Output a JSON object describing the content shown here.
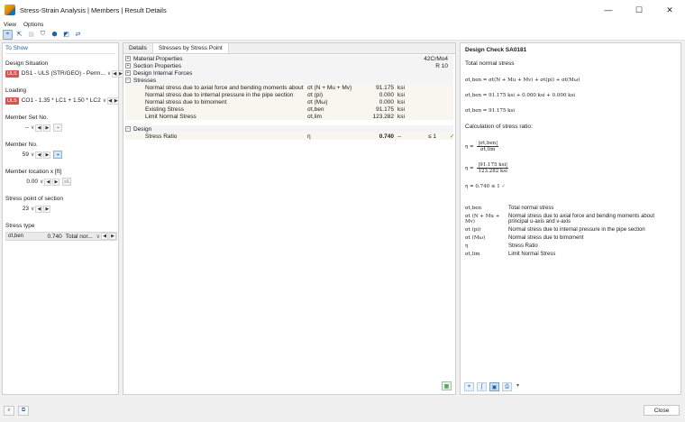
{
  "window": {
    "title": "Stress-Strain Analysis | Members | Result Details",
    "minimize": "—",
    "maximize": "☐",
    "close": "✕"
  },
  "menu": [
    "View",
    "Options"
  ],
  "left": {
    "header": "To Show",
    "design_situation": {
      "label": "Design Situation",
      "badge": "ULS",
      "value": "DS1 - ULS (STR/GEO) - Perm..."
    },
    "loading": {
      "label": "Loading",
      "badge": "ULS",
      "value": "CO1 - 1.35 * LC1 + 1.50 * LC2"
    },
    "member_set": {
      "label": "Member Set No.",
      "value": "--"
    },
    "member": {
      "label": "Member No.",
      "value": "59"
    },
    "location": {
      "label": "Member location x [ft]",
      "value": "0.00"
    },
    "stress_point": {
      "label": "Stress point of section",
      "value": "23"
    },
    "stress_type": {
      "label": "Stress type",
      "symbol": "σt,ben",
      "value": "0.740",
      "desc": "Total nor..."
    }
  },
  "center": {
    "tabs": [
      "Details",
      "Stresses by Stress Point"
    ],
    "sections": {
      "material": {
        "label": "Material Properties",
        "right": "42CrMo4"
      },
      "section": {
        "label": "Section Properties",
        "right": "R 10"
      },
      "internal_forces": {
        "label": "Design Internal Forces"
      },
      "stresses": {
        "label": "Stresses"
      },
      "design": {
        "label": "Design"
      }
    },
    "stress_rows": [
      {
        "label": "Normal stress due to axial force and bending moments about prin...",
        "sym": "σt (N + Mu + Mv)",
        "val": "91.175",
        "unit": "ksi"
      },
      {
        "label": "Normal stress due to internal pressure in the pipe section",
        "sym": "σt (pi)",
        "val": "0.000",
        "unit": "ksi"
      },
      {
        "label": "Normal stress due to bimoment",
        "sym": "σt (Mω)",
        "val": "0.000",
        "unit": "ksi"
      },
      {
        "label": "Existing Stress",
        "sym": "σt,ben",
        "val": "91.175",
        "unit": "ksi"
      },
      {
        "label": "Limit Normal Stress",
        "sym": "σt,lim",
        "val": "123.282",
        "unit": "ksi"
      }
    ],
    "design_row": {
      "label": "Stress Ratio",
      "sym": "η",
      "val": "0.740",
      "unit": "--",
      "cond": "≤ 1",
      "check": "✓"
    }
  },
  "right": {
    "title": "Design Check SA0181",
    "subtitle": "Total normal stress",
    "f1": "σt,ben = σt(N + Mu + Mv) + σt(pi) + σt(Mω)",
    "f2": "σt,ben = 91.175 ksi + 0.000 ksi + 0.000 ksi",
    "f3": "σt,ben = 91.175 ksi",
    "calc_text": "Calculation of stress ratio:",
    "f4_lhs": "η =",
    "f4_num": "|σt,ben|",
    "f4_den": "σt,lim",
    "f5_lhs": "η =",
    "f5_num": "|91.175 ksi|",
    "f5_den": "123.282 ksi",
    "f6": "η = 0.740 ≤ 1",
    "f6_check": "✓",
    "legend": [
      {
        "sym": "σt,ben",
        "desc": "Total normal stress"
      },
      {
        "sym": "σt (N + Mu + Mv)",
        "desc": "Normal stress due to axial force and bending moments about principal u-axis and v-axis"
      },
      {
        "sym": "σt (pi)",
        "desc": "Normal stress due to internal pressure in the pipe section"
      },
      {
        "sym": "σt (Mω)",
        "desc": "Normal stress due to bimoment"
      },
      {
        "sym": "η",
        "desc": "Stress Ratio"
      },
      {
        "sym": "σt,lim",
        "desc": "Limit Normal Stress"
      }
    ]
  },
  "status": {
    "close_label": "Close"
  }
}
